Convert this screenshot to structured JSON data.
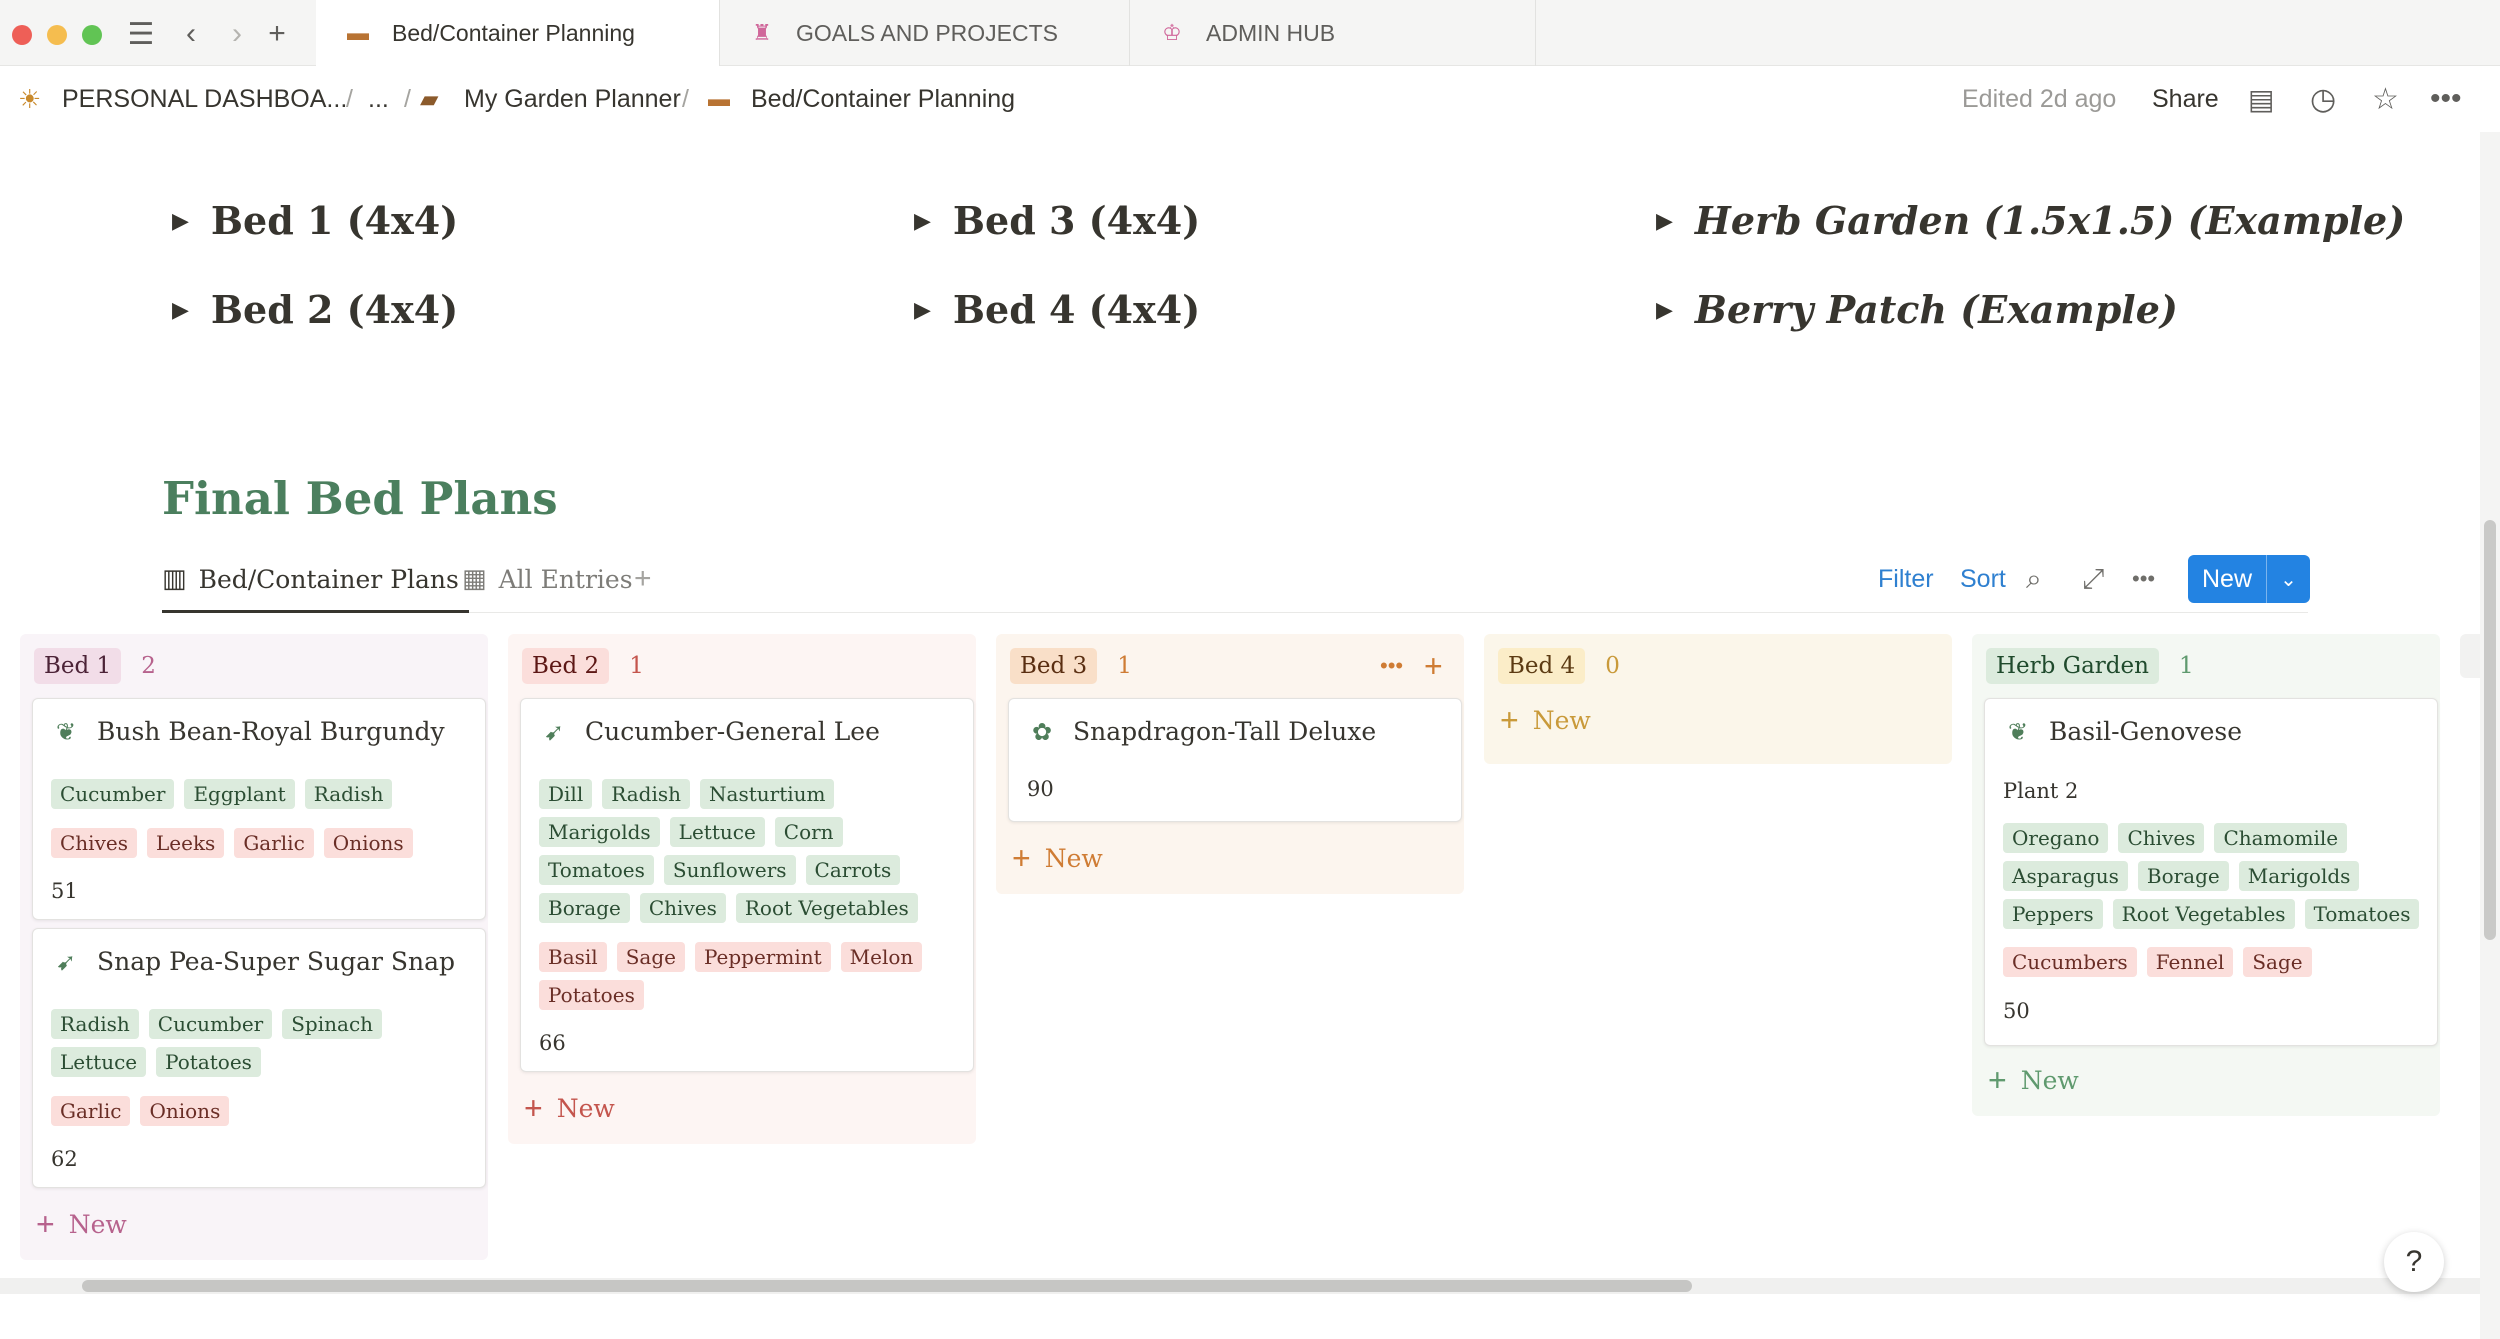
{
  "tabs": [
    {
      "label": "Bed/Container Planning",
      "icon": "bed-icon"
    },
    {
      "label": "GOALS AND PROJECTS",
      "icon": "cake-icon"
    },
    {
      "label": "ADMIN HUB",
      "icon": "trophy-icon"
    }
  ],
  "breadcrumb": {
    "root": "PERSONAL DASHBOA...",
    "ellipsis": "...",
    "parent": "My Garden Planner",
    "current": "Bed/Container Planning"
  },
  "header": {
    "edited": "Edited 2d ago",
    "share": "Share"
  },
  "toggles": [
    {
      "label": "Bed 1 (4x4)"
    },
    {
      "label": "Bed 2 (4x4)"
    },
    {
      "label": "Bed 3 (4x4)"
    },
    {
      "label": "Bed 4 (4x4)"
    },
    {
      "label": "Herb Garden (1.5x1.5) (Example)"
    },
    {
      "label": "Berry Patch (Example)"
    }
  ],
  "final_title": "Final Bed Plans",
  "views": {
    "board": "Bed/Container Plans",
    "table": "All Entries"
  },
  "toolbar": {
    "filter": "Filter",
    "sort": "Sort",
    "new": "New"
  },
  "columns": [
    {
      "name": "Bed 1",
      "count": "2",
      "new": "New",
      "cards": [
        {
          "title": "Bush Bean-Royal Burgundy",
          "icon": "leaf-icon",
          "green": [
            "Cucumber",
            "Eggplant",
            "Radish"
          ],
          "red": [
            "Chives",
            "Leeks",
            "Garlic",
            "Onions"
          ],
          "days": "51"
        },
        {
          "title": "Snap Pea-Super Sugar Snap",
          "icon": "carrot-icon",
          "green": [
            "Radish",
            "Cucumber",
            "Spinach",
            "Lettuce",
            "Potatoes"
          ],
          "red": [
            "Garlic",
            "Onions"
          ],
          "days": "62"
        }
      ]
    },
    {
      "name": "Bed 2",
      "count": "1",
      "new": "New",
      "cards": [
        {
          "title": "Cucumber-General Lee",
          "icon": "carrot-icon",
          "green": [
            "Dill",
            "Radish",
            "Nasturtium",
            "Marigolds",
            "Lettuce",
            "Corn",
            "Tomatoes",
            "Sunflowers",
            "Carrots",
            "Borage",
            "Chives",
            "Root Vegetables"
          ],
          "red": [
            "Basil",
            "Sage",
            "Peppermint",
            "Melon",
            "Potatoes"
          ],
          "days": "66"
        }
      ]
    },
    {
      "name": "Bed 3",
      "count": "1",
      "new": "New",
      "cards": [
        {
          "title": "Snapdragon-Tall Deluxe",
          "icon": "flower-icon",
          "days": "90"
        }
      ]
    },
    {
      "name": "Bed 4",
      "count": "0",
      "new": "New",
      "cards": []
    },
    {
      "name": "Herb Garden",
      "count": "1",
      "new": "New",
      "cards": [
        {
          "title": "Basil-Genovese",
          "icon": "leaf-icon",
          "plant": "Plant 2",
          "green": [
            "Oregano",
            "Chives",
            "Chamomile",
            "Asparagus",
            "Borage",
            "Marigolds",
            "Peppers",
            "Root Vegetables",
            "Tomatoes"
          ],
          "red": [
            "Cucumbers",
            "Fennel",
            "Sage"
          ],
          "days": "50"
        }
      ]
    }
  ],
  "colors": {
    "title_green": "#4b7f5e",
    "accent_blue": "#2383e2",
    "tag_green": "#dcebdd",
    "tag_red": "#fbdedb"
  },
  "help": "?"
}
